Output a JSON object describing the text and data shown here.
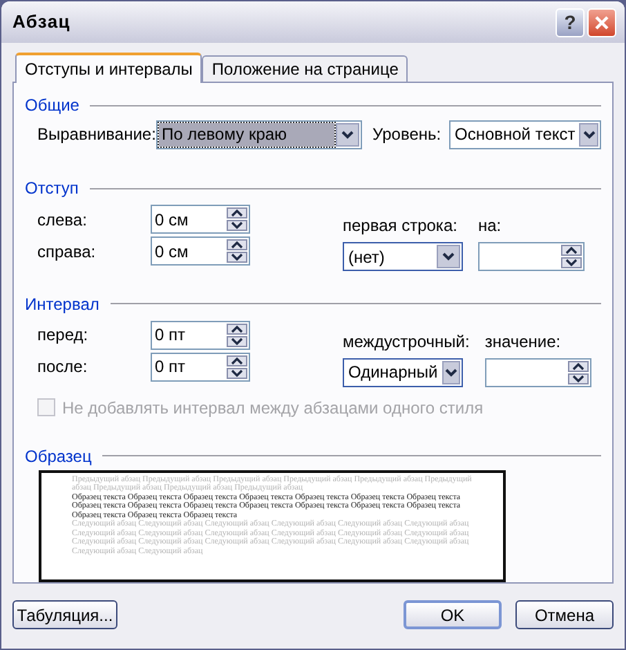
{
  "window": {
    "title": "Абзац",
    "help": "?"
  },
  "tabs": [
    {
      "label": "Отступы и интервалы",
      "selected": true
    },
    {
      "label": "Положение на странице",
      "selected": false
    }
  ],
  "general": {
    "title": "Общие",
    "alignment": {
      "label": "Выравнивание:",
      "value": "По левому краю",
      "focused": true
    },
    "level": {
      "label": "Уровень:",
      "value": "Основной текст",
      "focused": false
    }
  },
  "indent": {
    "title": "Отступ",
    "left": {
      "label": "слева:",
      "value": "0 см"
    },
    "right": {
      "label": "справа:",
      "value": "0 см"
    },
    "first_line": {
      "label": "первая строка:",
      "value": "(нет)"
    },
    "by": {
      "label": "на:"
    }
  },
  "spacing": {
    "title": "Интервал",
    "before": {
      "label": "перед:",
      "value": "0 пт"
    },
    "after": {
      "label": "после:",
      "value": "0 пт"
    },
    "line": {
      "label": "междустрочный:",
      "value": "Одинарный"
    },
    "at": {
      "label": "значение:"
    },
    "no_space": {
      "label": "Не добавлять интервал между абзацами одного стиля",
      "checked": false,
      "disabled": true
    }
  },
  "preview": {
    "title": "Образец",
    "previous": "Предыдущий абзац Предыдущий абзац Предыдущий абзац Предыдущий абзац Предыдущий абзац Предыдущий абзац Предыдущий абзац Предыдущий абзац Предыдущий абзац",
    "sample": "Образец текста Образец текста Образец текста Образец текста Образец текста Образец текста Образец текста Образец текста Образец текста Образец текста Образец текста Образец текста Образец текста Образец текста Образец текста Образец текста Образец текста",
    "next": "Следующий абзац Следующий абзац Следующий абзац Следующий абзац Следующий абзац Следующий абзац Следующий абзац Следующий абзац Следующий абзац Следующий абзац Следующий абзац Следующий абзац Следующий абзац Следующий абзац Следующий абзац Следующий абзац Следующий абзац Следующий абзац Следующий абзац Следующий абзац"
  },
  "footer": {
    "tabs_button": "Табуляция...",
    "ok": "OK",
    "cancel": "Отмена"
  }
}
